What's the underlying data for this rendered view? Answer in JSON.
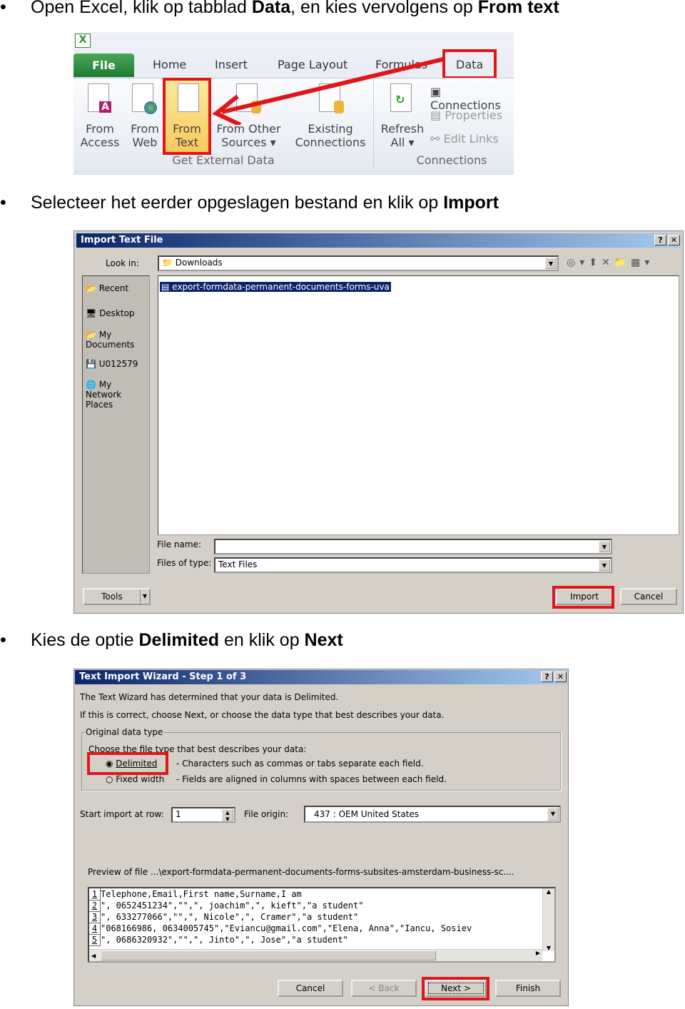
{
  "steps": [
    {
      "bullet": "•",
      "pre": "Open Excel, klik op tabblad ",
      "b1": "Data",
      "mid": ", en kies vervolgens op ",
      "b2": "From text"
    },
    {
      "bullet": "•",
      "pre": "Selecteer het eerder opgeslagen bestand en klik op ",
      "b1": "Import"
    },
    {
      "bullet": "•",
      "pre": "Kies de optie ",
      "b1": "Delimited",
      "mid": " en klik op ",
      "b2": "Next"
    }
  ],
  "ribbon": {
    "tabs": [
      "File",
      "Home",
      "Insert",
      "Page Layout",
      "Formulas",
      "Data"
    ],
    "buttons": [
      [
        "From",
        "Access"
      ],
      [
        "From",
        "Web"
      ],
      [
        "From",
        "Text"
      ],
      [
        "From Other",
        "Sources ▾"
      ],
      [
        "Existing",
        "Connections"
      ],
      [
        "Refresh",
        "All ▾"
      ]
    ],
    "small": [
      "Connections",
      "Properties",
      "Edit Links"
    ],
    "groups": [
      "Get External Data",
      "Connections"
    ],
    "file_tab_color": "#2f8a3a",
    "highlight_color": "#e0161b"
  },
  "import_dialog": {
    "title": "Import Text File",
    "look_in_label": "Look in:",
    "look_in_value": "Downloads",
    "places": [
      "Recent",
      "Desktop",
      "My Documents",
      "U012579",
      "My Network Places"
    ],
    "file": "export-formdata-permanent-documents-forms-uva",
    "file_name_label": "File name:",
    "file_name_value": "",
    "file_type_label": "Files of type:",
    "file_type_value": "Text Files",
    "tools": "Tools",
    "import": "Import",
    "cancel": "Cancel"
  },
  "wizard": {
    "title": "Text Import Wizard - Step 1 of 3",
    "line1": "The Text Wizard has determined that your data is Delimited.",
    "line2": "If this is correct, choose Next, or choose the data type that best describes your data.",
    "group": "Original data type",
    "choose": "Choose the file type that best describes your data:",
    "opt1": "Delimited",
    "opt1_desc": "- Characters such as commas or tabs separate each field.",
    "opt2": "Fixed width",
    "opt2_desc": "- Fields are aligned in columns with spaces between each field.",
    "selected": "Delimited",
    "start_label": "Start import at row:",
    "start_value": "1",
    "origin_label": "File origin:",
    "origin_value": "437 : OEM United States",
    "preview_label": "Preview of file ...\\export-formdata-permanent-documents-forms-subsites-amsterdam-business-sc....",
    "preview_rows": [
      {
        "n": "1",
        "t": "Telephone,Email,First name,Surname,I am"
      },
      {
        "n": "2",
        "t": "\", 0652451234\",\"\",\", joachim\",\", kieft\",\"a student\""
      },
      {
        "n": "3",
        "t": "\", 633277066\",\"\",\", Nicole\",\", Cramer\",\"a student\""
      },
      {
        "n": "4",
        "t": "\"068166986, 0634005745\",\"Eviancu@gmail.com\",\"Elena, Anna\",\"Iancu, Sosiev"
      },
      {
        "n": "5",
        "t": "\", 0686320932\",\"\",\", Jinto\",\", Jose\",\"a student\""
      }
    ],
    "cancel": "Cancel",
    "back": "< Back",
    "next": "Next >",
    "finish": "Finish"
  }
}
